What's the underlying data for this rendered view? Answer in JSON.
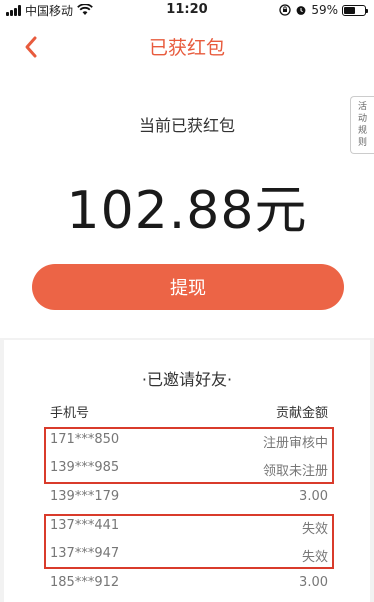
{
  "status_bar": {
    "carrier": "中国移动",
    "time": "11:20",
    "battery": "59%"
  },
  "nav": {
    "title": "已获红包"
  },
  "rules_tab": {
    "label": "活动规则"
  },
  "hero": {
    "label": "当前已获红包",
    "amount": "102.88元"
  },
  "withdraw": {
    "label": "提现"
  },
  "invited": {
    "title": "·已邀请好友·",
    "col_phone": "手机号",
    "col_amount": "贡献金额",
    "rows": [
      {
        "phone": "171***850",
        "amount": "注册审核中"
      },
      {
        "phone": "139***985",
        "amount": "领取未注册"
      },
      {
        "phone": "139***179",
        "amount": "3.00"
      },
      {
        "phone": "137***441",
        "amount": "失效"
      },
      {
        "phone": "137***947",
        "amount": "失效"
      },
      {
        "phone": "185***912",
        "amount": "3.00"
      }
    ]
  },
  "colors": {
    "accent": "#ec6446",
    "highlight_border": "#d93b2b"
  }
}
